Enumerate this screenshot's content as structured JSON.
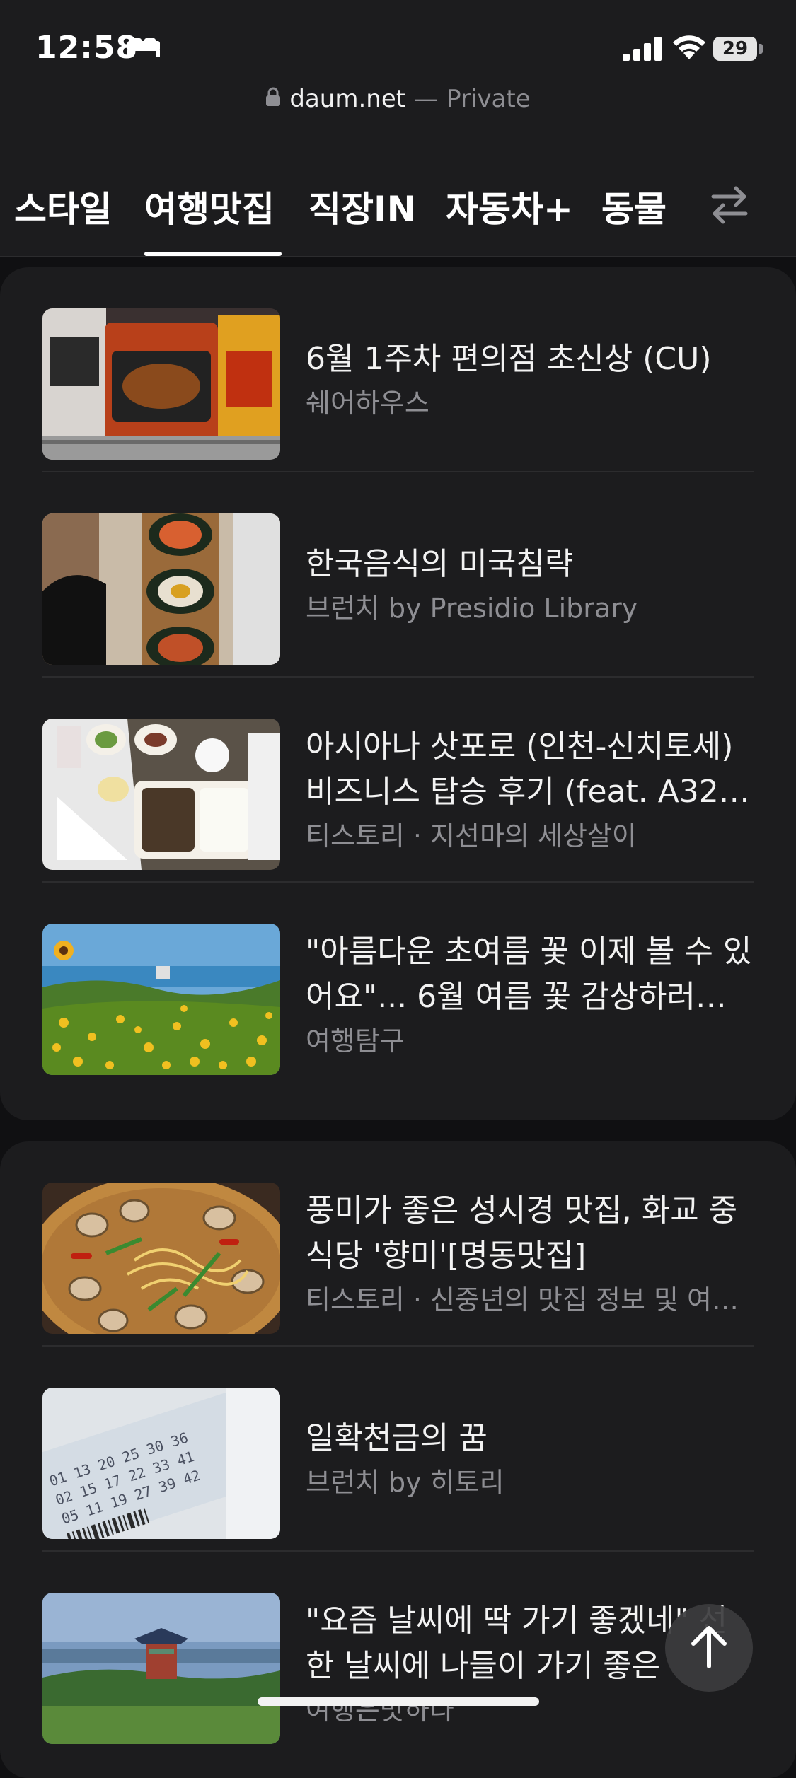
{
  "status_bar": {
    "time": "12:58",
    "battery": "29"
  },
  "url_bar": {
    "domain": "daum.net",
    "separator": "—",
    "mode": "Private"
  },
  "tabs": [
    {
      "label": "스타일"
    },
    {
      "label": "여행맛집",
      "active": true
    },
    {
      "label": "직장IN"
    },
    {
      "label": "자동차+"
    },
    {
      "label": "동물"
    }
  ],
  "card1": {
    "items": [
      {
        "title": "6월 1주차 편의점 초신상 (CU)",
        "source": "쉐어하우스",
        "thumb": "convenience-store-bbq-box"
      },
      {
        "title": "한국음식의 미국침략",
        "source": "브런치 by Presidio Library",
        "thumb": "kimbap-roll"
      },
      {
        "title": "아시아나 삿포로 (인천-신치토세) 비즈니스 탑승 후기 (feat. A32…",
        "source": "티스토리 · 지선마의 세상살이",
        "thumb": "airline-meal-tray"
      },
      {
        "title": "\"아름다운 초여름 꽃 이제 볼 수 있어요\"... 6월 여름 꽃 감상하러…",
        "source": "여행탐구",
        "thumb": "yellow-flower-field"
      }
    ]
  },
  "card2": {
    "items": [
      {
        "title": "풍미가 좋은 성시경 맛집, 화교 중식당 '향미'[명동맛집]",
        "source": "티스토리 · 신중년의 맛집 정보 및 여…",
        "thumb": "clam-noodles"
      },
      {
        "title": "일확천금의 꿈",
        "source": "브런치 by 히토리",
        "thumb": "lotto-ticket"
      },
      {
        "title": "\"요즘 날씨에 딱 가기 좋겠네\" 선한 날씨에 나들이 가기 좋은",
        "source": "여행은맛하다",
        "thumb": "pavilion-landscape"
      }
    ]
  },
  "colors": {
    "background": "#101012",
    "card": "#1c1c1e",
    "primary_text": "#f2f2f2",
    "secondary_text": "#8e8e93"
  }
}
